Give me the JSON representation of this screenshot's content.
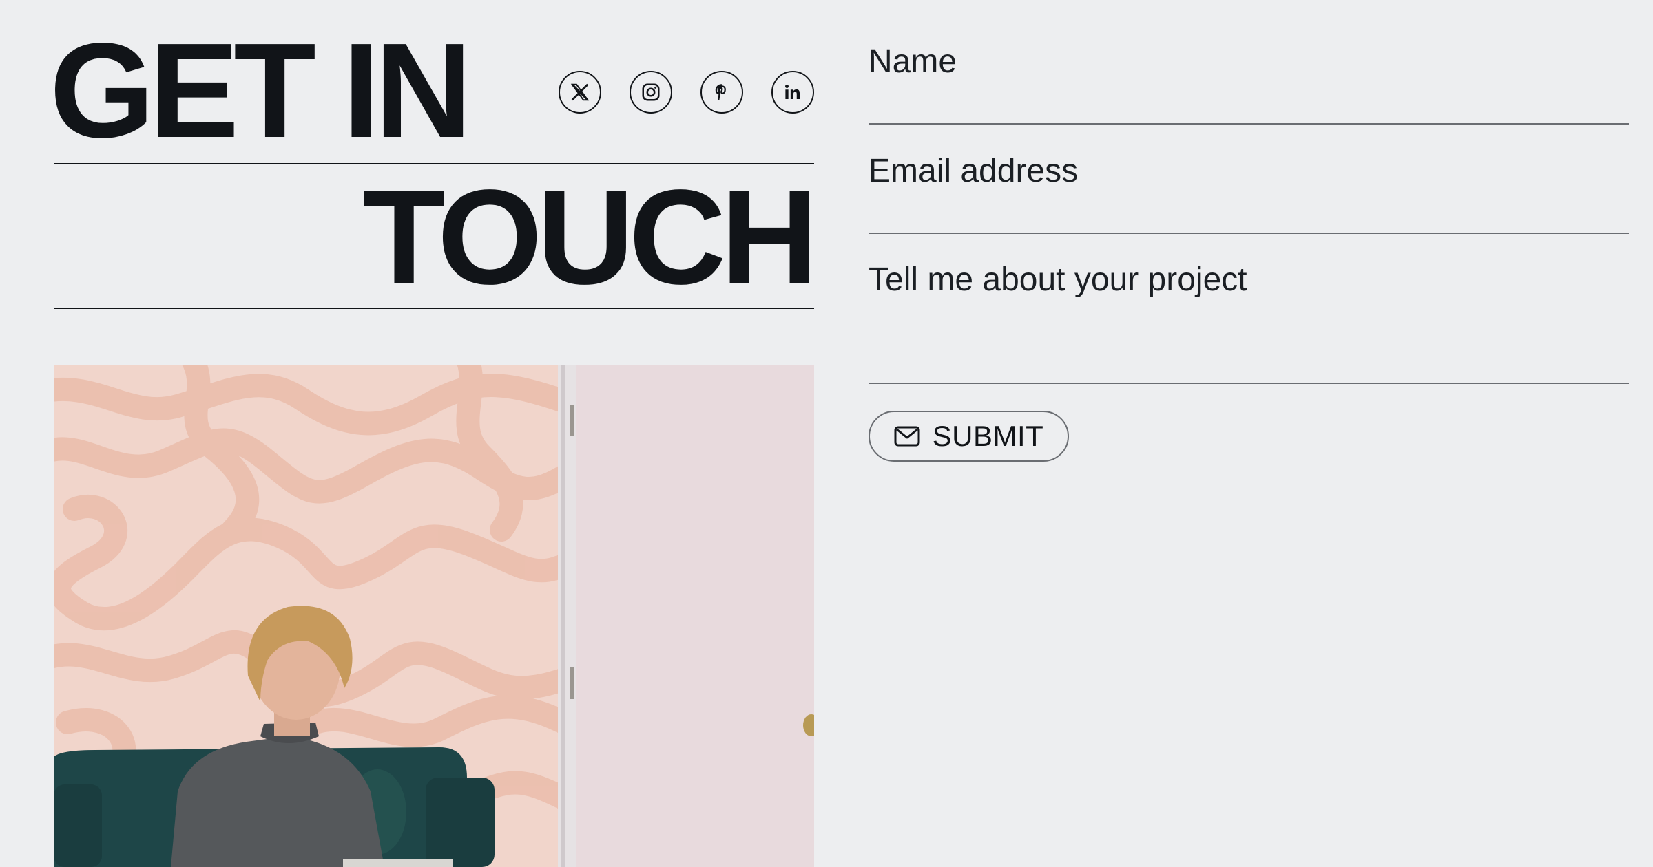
{
  "headline": {
    "line1": "GET IN",
    "line2": "TOUCH"
  },
  "social": [
    {
      "name": "x-icon",
      "label": "X"
    },
    {
      "name": "instagram-icon",
      "label": "Instagram"
    },
    {
      "name": "pinterest-icon",
      "label": "Pinterest"
    },
    {
      "name": "linkedin-icon",
      "label": "LinkedIn"
    }
  ],
  "form": {
    "name_placeholder": "Name",
    "email_placeholder": "Email address",
    "project_placeholder": "Tell me about your project",
    "submit_label": "SUBMIT",
    "submit_icon": "mail-icon"
  },
  "photo": {
    "subject": "person-with-laptop-photo"
  },
  "colors": {
    "background": "#edeef0",
    "text": "#111418",
    "field_rule": "#6a6d72",
    "wall_pink": "#f0d0c4",
    "sofa_teal": "#1f4a4c"
  }
}
